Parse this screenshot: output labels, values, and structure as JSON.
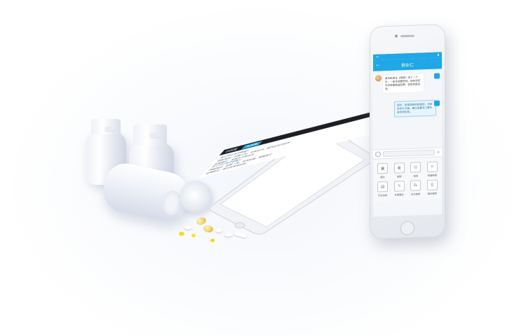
{
  "scene": {
    "description_hidden": false
  },
  "phone_right": {
    "status": {
      "left": "•••",
      "right": "▮"
    },
    "header": {
      "back_glyph": "←",
      "title": "柳女仁"
    },
    "chat": {
      "incoming_message": "某日给谢诊《喝茶》活了一个月，一级诊室要是到。如何测药实这里面都些回事，如后到医后后。",
      "outgoing_message": "您好，您发现有的的描述，也有诊所大方面，建议采集专门医生会诊和化验。"
    },
    "tools": [
      {
        "label": "图片",
        "icon": "image-icon"
      },
      {
        "label": "拍照",
        "icon": "camera-icon"
      },
      {
        "label": "电话",
        "icon": "phone-icon"
      },
      {
        "label": "快捷用语",
        "icon": "quick-reply-icon"
      },
      {
        "label": "问诊总结",
        "icon": "summary-icon"
      },
      {
        "label": "处置建议",
        "icon": "advice-icon"
      },
      {
        "label": "处方推荐",
        "icon": "prescription-icon"
      },
      {
        "label": "随访管理",
        "icon": "followup-icon"
      }
    ]
  },
  "phone_flat": {
    "header": {
      "tab_1": "已回复",
      "tab_2": "未回复"
    },
    "rows": [
      "图文问诊请求患者A",
      "患者描述：头痛三天，伴有低热，服药后未见好转",
      "处理建议：多喝水注意休息",
      "图文问诊请求患者B",
      "患者描述：咳嗽一周，夜间加重，需要复诊",
      "处理建议：建议血常规检查"
    ]
  }
}
